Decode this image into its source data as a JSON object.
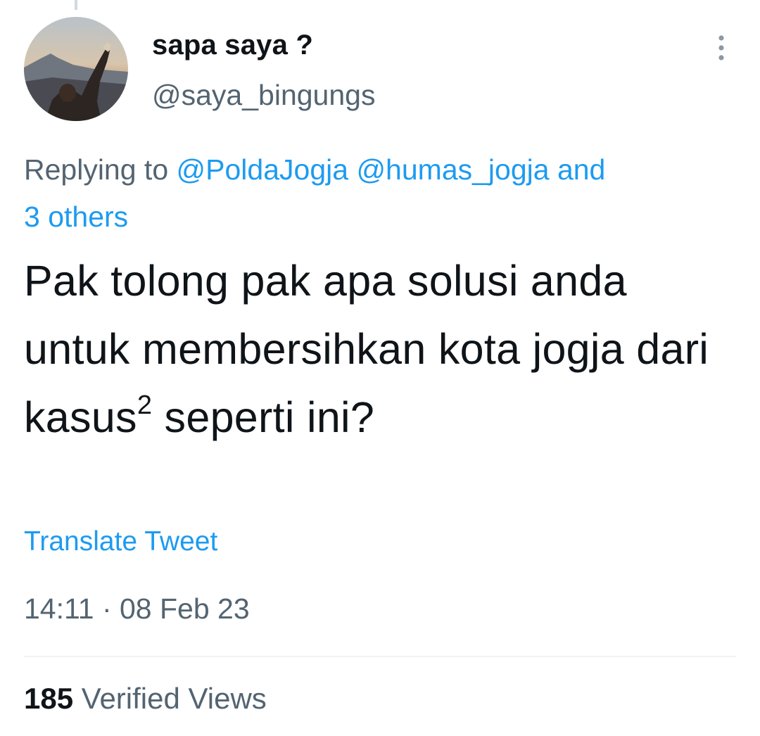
{
  "tweet": {
    "author": {
      "display_name": "sapa saya ?",
      "handle": "@saya_bingungs",
      "avatar_icon": "profile-photo-mountain-sunset"
    },
    "more_icon": "more-vertical-icon",
    "replying": {
      "prefix": "Replying to",
      "mentions": [
        "@PoldaJogja",
        "@humas_jogja"
      ],
      "conjunction": "and",
      "others": "3 others"
    },
    "text": {
      "before_superscript": "Pak tolong pak apa solusi anda untuk membersihkan kota jogja dari kasus",
      "superscript": "2",
      "after_superscript": " seperti ini?"
    },
    "translate_label": "Translate Tweet",
    "timestamp": "14:11 · 08 Feb 23",
    "views": {
      "count": "185",
      "label": "Verified Views"
    }
  },
  "colors": {
    "text_primary": "#0f1419",
    "text_secondary": "#536471",
    "link": "#1d9bf0",
    "divider": "#eff3f4"
  }
}
